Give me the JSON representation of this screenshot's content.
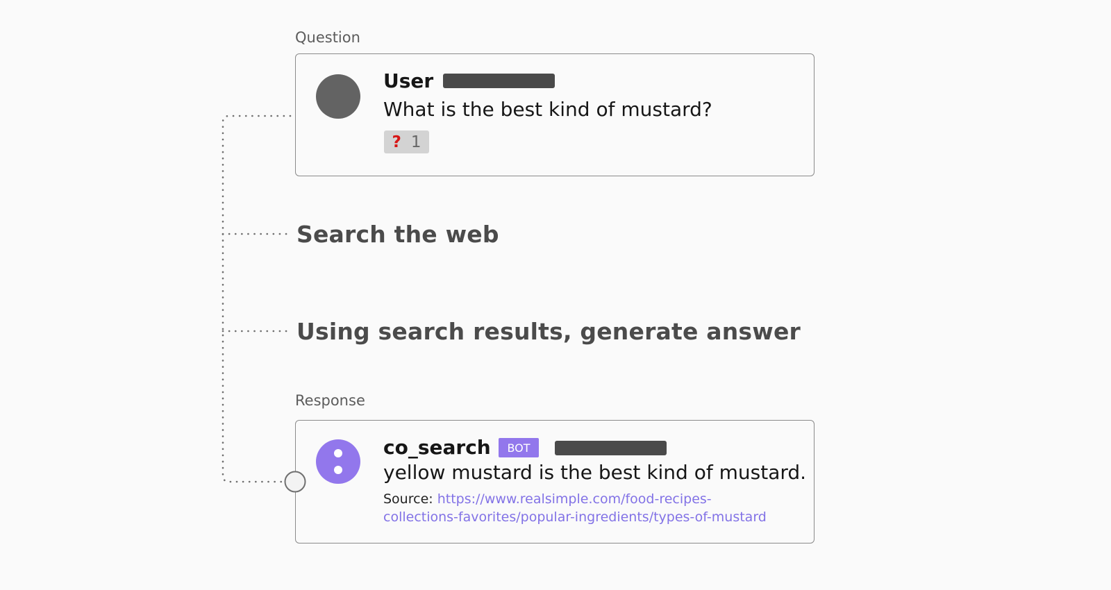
{
  "question": {
    "label": "Question",
    "author": "User",
    "text": "What is the best kind of mustard?",
    "reaction": {
      "emoji": "?",
      "count": "1"
    }
  },
  "steps": [
    {
      "label": "Search the web"
    },
    {
      "label": "Using search results, generate answer"
    }
  ],
  "response": {
    "label": "Response",
    "author": "co_search",
    "badge": "BOT",
    "text": "yellow mustard is the best kind of mustard.",
    "source_prefix": "Source:",
    "source_url_line1": "https://www.realsimple.com/food-recipes-",
    "source_url_line2": "collections-favorites/popular-ingredients/types-of-mustard",
    "accent_color": "#9277ec"
  }
}
